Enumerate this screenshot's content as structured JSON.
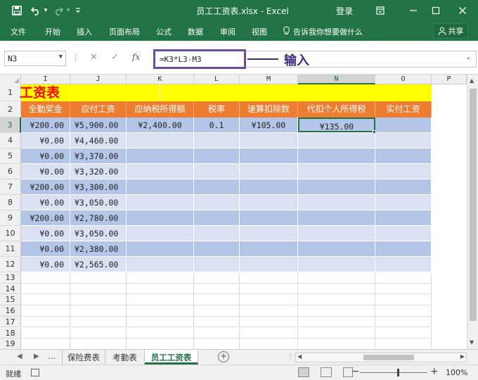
{
  "titlebar": {
    "title": "员工工资表.xlsx  -  Excel",
    "login": "登录",
    "undo_dropdown": "▾",
    "customize": "₸"
  },
  "ribbon": {
    "tabs": [
      "文件",
      "开始",
      "插入",
      "页面布局",
      "公式",
      "数据",
      "审阅",
      "视图"
    ],
    "tell_me": "告诉我你想要做什么",
    "share": "共享"
  },
  "formula_bar": {
    "name_box": "N3",
    "formula": "=K3*L3-M3",
    "fx": "fx",
    "callout": "输入"
  },
  "columns": [
    {
      "letter": "I"
    },
    {
      "letter": "J"
    },
    {
      "letter": "K"
    },
    {
      "letter": "L"
    },
    {
      "letter": "M"
    },
    {
      "letter": "N",
      "selected": true
    },
    {
      "letter": "O"
    },
    {
      "letter": "P"
    }
  ],
  "sheet": {
    "title_row": {
      "row": "1",
      "text": "工资表"
    },
    "headers": {
      "row": "2",
      "cells": [
        "全勤奖金",
        "应付工资",
        "应纳税所得额",
        "税率",
        "速算扣除数",
        "代扣个人所得税",
        "实付工资"
      ]
    },
    "rows": [
      {
        "row": "3",
        "cells": [
          "¥200.00",
          "¥5,900.00",
          "¥2,400.00",
          "0.1",
          "¥105.00",
          "¥135.00",
          ""
        ]
      },
      {
        "row": "4",
        "cells": [
          "¥0.00",
          "¥4,460.00",
          "",
          "",
          "",
          "",
          ""
        ]
      },
      {
        "row": "5",
        "cells": [
          "¥0.00",
          "¥3,370.00",
          "",
          "",
          "",
          "",
          ""
        ]
      },
      {
        "row": "6",
        "cells": [
          "¥0.00",
          "¥3,320.00",
          "",
          "",
          "",
          "",
          ""
        ]
      },
      {
        "row": "7",
        "cells": [
          "¥200.00",
          "¥3,300.00",
          "",
          "",
          "",
          "",
          ""
        ]
      },
      {
        "row": "8",
        "cells": [
          "¥0.00",
          "¥3,050.00",
          "",
          "",
          "",
          "",
          ""
        ]
      },
      {
        "row": "9",
        "cells": [
          "¥200.00",
          "¥2,780.00",
          "",
          "",
          "",
          "",
          ""
        ]
      },
      {
        "row": "10",
        "cells": [
          "¥0.00",
          "¥3,050.00",
          "",
          "",
          "",
          "",
          ""
        ]
      },
      {
        "row": "11",
        "cells": [
          "¥0.00",
          "¥2,380.00",
          "",
          "",
          "",
          "",
          ""
        ]
      },
      {
        "row": "12",
        "cells": [
          "¥0.00",
          "¥2,565.00",
          "",
          "",
          "",
          "",
          ""
        ]
      }
    ],
    "empty_rows": [
      "13",
      "14",
      "15",
      "16",
      "17",
      "18",
      "19"
    ]
  },
  "tabs_row": {
    "ellipsis": "...",
    "sheet_tabs": [
      {
        "label": "保险费表",
        "active": false
      },
      {
        "label": "考勤表",
        "active": false
      },
      {
        "label": "员工工资表",
        "active": true
      }
    ],
    "add": "+"
  },
  "status": {
    "text": "就绪",
    "zoom": "100%"
  },
  "colors": {
    "excel_green": "#217346",
    "title_fill": "#ffff00",
    "title_text": "#ff0000",
    "header_fill": "#ed7d31",
    "band_dark": "#b4c6e7",
    "band_light": "#d9e1f2",
    "callout": "#3e2a80"
  }
}
